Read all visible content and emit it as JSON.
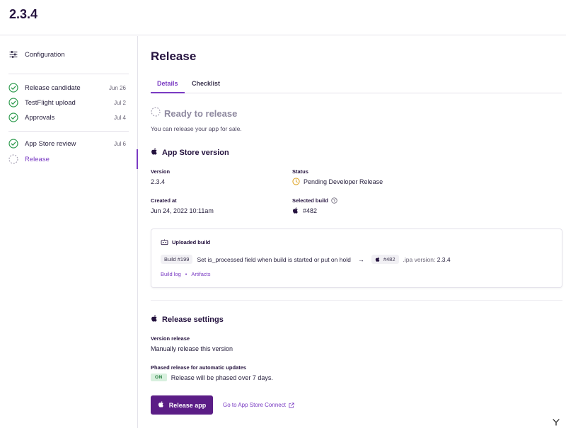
{
  "header": {
    "version": "2.3.4"
  },
  "sidebar": {
    "config_label": "Configuration",
    "items": [
      {
        "label": "Release candidate",
        "date": "Jun 26",
        "state": "done"
      },
      {
        "label": "TestFlight upload",
        "date": "Jul 2",
        "state": "done"
      },
      {
        "label": "Approvals",
        "date": "Jul 4",
        "state": "done"
      },
      {
        "label": "App Store review",
        "date": "Jul 6",
        "state": "done"
      },
      {
        "label": "Release",
        "date": "",
        "state": "active"
      }
    ]
  },
  "main": {
    "title": "Release",
    "tabs": [
      {
        "label": "Details",
        "active": true
      },
      {
        "label": "Checklist",
        "active": false
      }
    ],
    "status": {
      "title": "Ready to release",
      "subtitle": "You can release your app for sale."
    },
    "app_store_version": {
      "heading": "App Store version",
      "version_label": "Version",
      "version_value": "2.3.4",
      "status_label": "Status",
      "status_value": "Pending Developer Release",
      "created_label": "Created at",
      "created_value": "Jun 24, 2022 10:11am",
      "selected_build_label": "Selected build",
      "selected_build_value": "#482"
    },
    "uploaded_build": {
      "heading": "Uploaded build",
      "build_tag": "Build #199",
      "message": "Set is_processed field when build is started or put on hold",
      "arrow": "→",
      "store_build": "#482",
      "ipa_label": ".ipa version:",
      "ipa_version": "2.3.4",
      "link_log": "Build log",
      "link_sep": "•",
      "link_artifacts": "Artifacts"
    },
    "release_settings": {
      "heading": "Release settings",
      "version_release_label": "Version release",
      "version_release_value": "Manually release this version",
      "phased_label": "Phased release for automatic updates",
      "phased_badge": "ON",
      "phased_value": "Release will be phased over 7 days."
    },
    "actions": {
      "release_button": "Release app",
      "connect_link": "Go to App Store Connect"
    }
  },
  "colors": {
    "accent": "#7a3bc3",
    "primary_button": "#5b1d86",
    "success": "#2e9b4e",
    "warning": "#e0a82e",
    "on_badge_bg": "#d8f0de"
  }
}
